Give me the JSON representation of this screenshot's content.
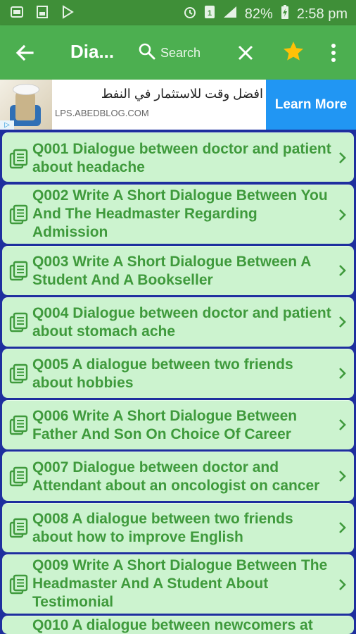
{
  "status_bar": {
    "battery": "82%",
    "time": "2:58 pm"
  },
  "app_bar": {
    "title": "Dia...",
    "search_label": "Search"
  },
  "ad": {
    "headline": "افضل وقت للاستثمار في النفط",
    "domain": "LPS.ABEDBLOG.COM",
    "cta": "Learn More"
  },
  "items": [
    {
      "label": "Q001 Dialogue between doctor and patient about headache"
    },
    {
      "label": "Q002 Write A Short Dialogue Between You And The Headmaster Regarding Admission"
    },
    {
      "label": "Q003 Write A Short Dialogue Between A Student And A Bookseller"
    },
    {
      "label": "Q004 Dialogue between doctor and patient about stomach ache"
    },
    {
      "label": "Q005 A dialogue between two friends about hobbies"
    },
    {
      "label": "Q006 Write A Short Dialogue Between Father And Son On Choice Of Career"
    },
    {
      "label": "Q007 Dialogue between doctor and Attendant about an oncologist on cancer"
    },
    {
      "label": "Q008 A dialogue between two friends about how to improve English"
    },
    {
      "label": "Q009 Write A Short Dialogue Between The Headmaster And A Student About Testimonial"
    },
    {
      "label": "Q010 A dialogue between newcomers at"
    }
  ],
  "colors": {
    "status_bar": "#3f8f38",
    "app_bar": "#4caf50",
    "list_background": "#1e2f9e",
    "item_background": "#ccf3cf",
    "item_text": "#3f9a3c",
    "star": "#ffc107",
    "ad_button": "#2196f3"
  },
  "icons": {
    "back": "arrow-left-icon",
    "search": "search-icon",
    "close": "close-icon",
    "favorite": "star-icon",
    "more": "more-vert-icon",
    "item": "document-list-icon",
    "chevron": "chevron-right-icon"
  }
}
